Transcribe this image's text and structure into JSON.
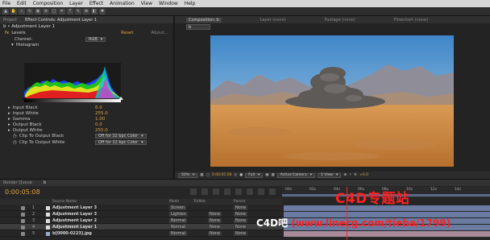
{
  "menu": [
    "File",
    "Edit",
    "Composition",
    "Layer",
    "Effect",
    "Animation",
    "View",
    "Window",
    "Help"
  ],
  "left_panel": {
    "tabs": [
      "Project",
      "Effect Controls: Adjustment Layer 1"
    ],
    "layer_label": "b • Adjustment Layer 1",
    "effect": {
      "name": "Levels",
      "reset": "Reset",
      "about": "About..."
    },
    "channel_label": "Channel:",
    "channel_value": "RGB",
    "histogram_label": "Histogram",
    "params": [
      {
        "label": "Input Black",
        "value": "6.0"
      },
      {
        "label": "Input White",
        "value": "255.0"
      },
      {
        "label": "Gamma",
        "value": "1.00"
      },
      {
        "label": "Output Black",
        "value": "0.0"
      },
      {
        "label": "Output White",
        "value": "255.0"
      }
    ],
    "clip_black": {
      "label": "Clip To Output Black",
      "value": "Off for 32 bpc Color"
    },
    "clip_white": {
      "label": "Clip To Output White",
      "value": "Off for 32 bpc Color"
    }
  },
  "comp_panel": {
    "tabs": [
      "Composition: b",
      "Layer (none)",
      "Footage (none)",
      "Flowchart (none)"
    ],
    "comp_selector": "b",
    "viewer_bar": {
      "zoom": "50%",
      "timecode": "0:00:05:08",
      "resolution": "Full",
      "camera": "Active Camera",
      "view": "1 View",
      "exposure": "+0.0"
    }
  },
  "timeline": {
    "tabs": [
      "Render Queue",
      "b"
    ],
    "timecode": "0:00:05:08",
    "ruler_labels": [
      "00s",
      "02s",
      "04s",
      "06s",
      "08s",
      "10s",
      "12s",
      "14s"
    ],
    "columns": {
      "source": "Source Name",
      "mode": "Mode",
      "trkmat": "TrkMat",
      "parent": "Parent"
    },
    "layers": [
      {
        "num": "1",
        "name": "Adjustment Layer 3",
        "mode": "Screen",
        "trkmat": "",
        "parent": "None",
        "color": "#d8d8d8",
        "selected": false
      },
      {
        "num": "2",
        "name": "Adjustment Layer 3",
        "mode": "Lighten",
        "trkmat": "None",
        "parent": "None",
        "color": "#d8d8d8",
        "selected": false
      },
      {
        "num": "3",
        "name": "Adjustment Layer 2",
        "mode": "Normal",
        "trkmat": "None",
        "parent": "None",
        "color": "#d8d8d8",
        "selected": false
      },
      {
        "num": "4",
        "name": "Adjustment Layer 1",
        "mode": "Normal",
        "trkmat": "None",
        "parent": "None",
        "color": "#d8d8d8",
        "selected": true
      },
      {
        "num": "5",
        "name": "b[0000-0223].jpg",
        "mode": "Normal",
        "trkmat": "None",
        "parent": "None",
        "color": "#b8d8e8",
        "selected": false
      }
    ]
  },
  "watermark": {
    "line1": "C4D专题站",
    "line2_prefix": "C4D吧",
    "line2_url": "(www.linecg.com/tieba/1799)"
  }
}
